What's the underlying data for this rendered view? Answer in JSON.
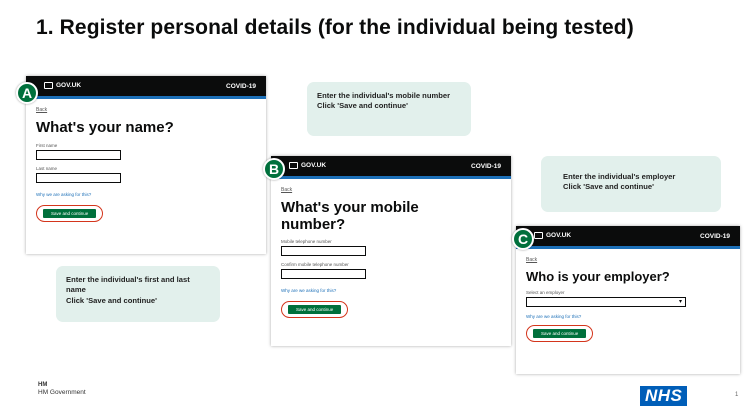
{
  "title": "1. Register personal details (for the individual being tested)",
  "notes": {
    "mobile": [
      "Enter the individual's mobile number",
      "Click 'Save and continue'"
    ],
    "employer": [
      "Enter the individual's employer",
      "Click 'Save and continue'"
    ],
    "name": [
      "Enter the individual's first and last name",
      "Click 'Save and continue'"
    ]
  },
  "screens": {
    "a": {
      "badge": "A",
      "brand": "GOV.UK",
      "service": "COVID-19",
      "back": "Back",
      "heading": "What's your name?",
      "field1_label": "First name",
      "field2_label": "Last name",
      "help_link": "Why we are asking for this?",
      "button": "Save and continue"
    },
    "b": {
      "badge": "B",
      "brand": "GOV.UK",
      "service": "COVID-19",
      "back": "Back",
      "heading": "What's your mobile number?",
      "field1_label": "Mobile telephone number",
      "field2_label": "Confirm mobile telephone number",
      "help_link": "Why are we asking for this?",
      "button": "Save and continue"
    },
    "c": {
      "badge": "C",
      "brand": "GOV.UK",
      "service": "COVID-19",
      "back": "Back",
      "heading": "Who is your employer?",
      "field1_label": "Select an employer",
      "help_link": "Why are we asking for this?",
      "button": "Save and continue"
    }
  },
  "footer": {
    "gov_line1": "HM",
    "gov_line2": "HM Government",
    "nhs": "NHS",
    "page": "1"
  },
  "colors": {
    "govuk_black": "#0b0c0c",
    "govuk_green": "#00703c",
    "note_bg": "#e2f0ec",
    "nhs_blue": "#005eb8",
    "highlight_red": "#d4351c"
  }
}
